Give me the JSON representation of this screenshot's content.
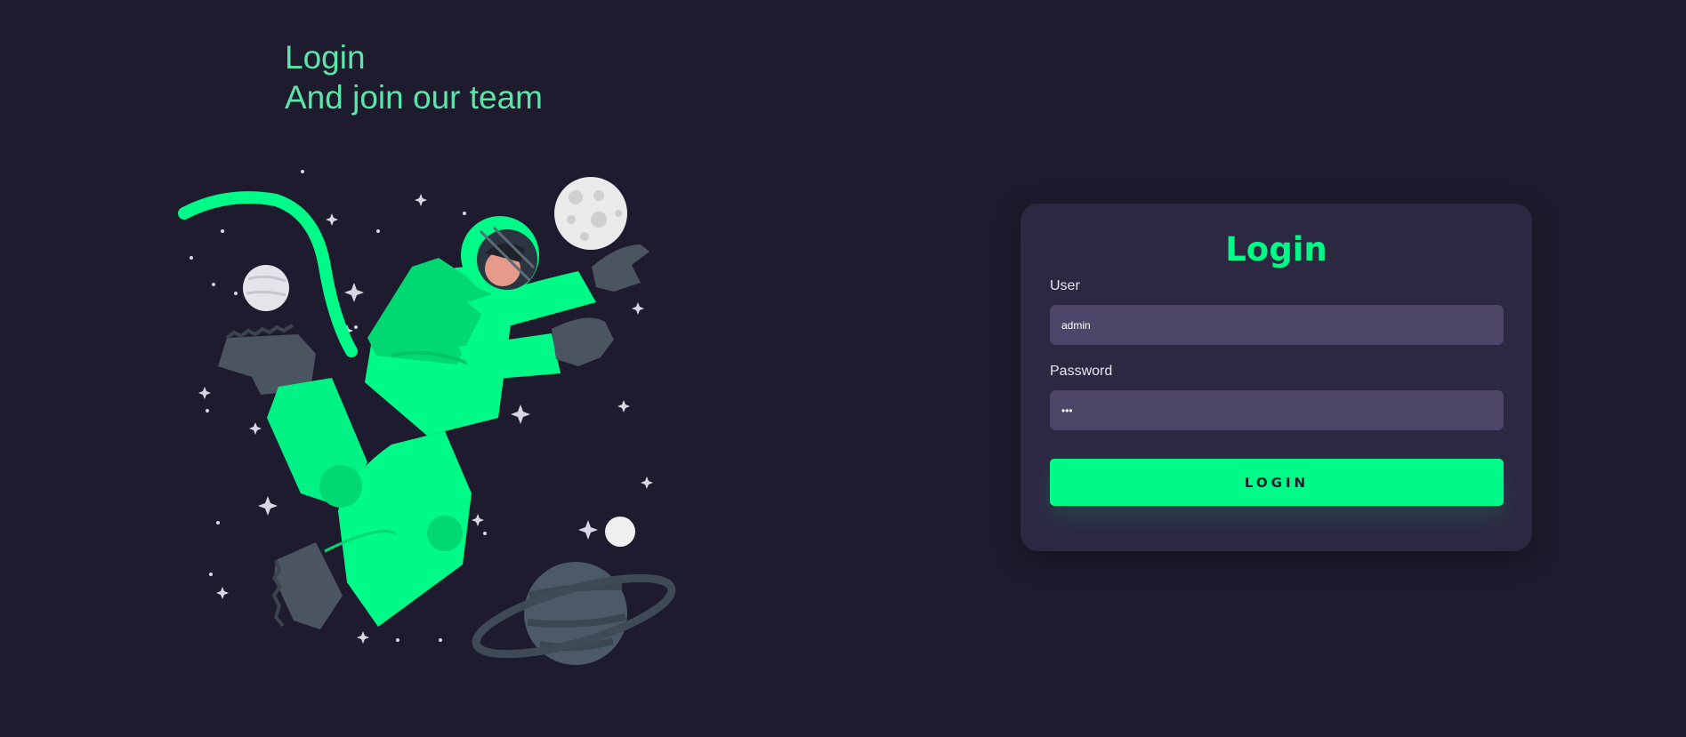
{
  "hero": {
    "line1": "Login",
    "line2": "And join our team"
  },
  "illustration": {
    "icon": "astronaut-illustration-icon"
  },
  "form": {
    "title": "Login",
    "user_label": "User",
    "user_value": "admin",
    "password_label": "Password",
    "password_value": "•••",
    "submit_label": "LOGIN"
  },
  "colors": {
    "background": "#1f1b2e",
    "card": "#2d2842",
    "input": "#4e4669",
    "accent": "#00fa87",
    "heading": "#5ce5a8"
  }
}
